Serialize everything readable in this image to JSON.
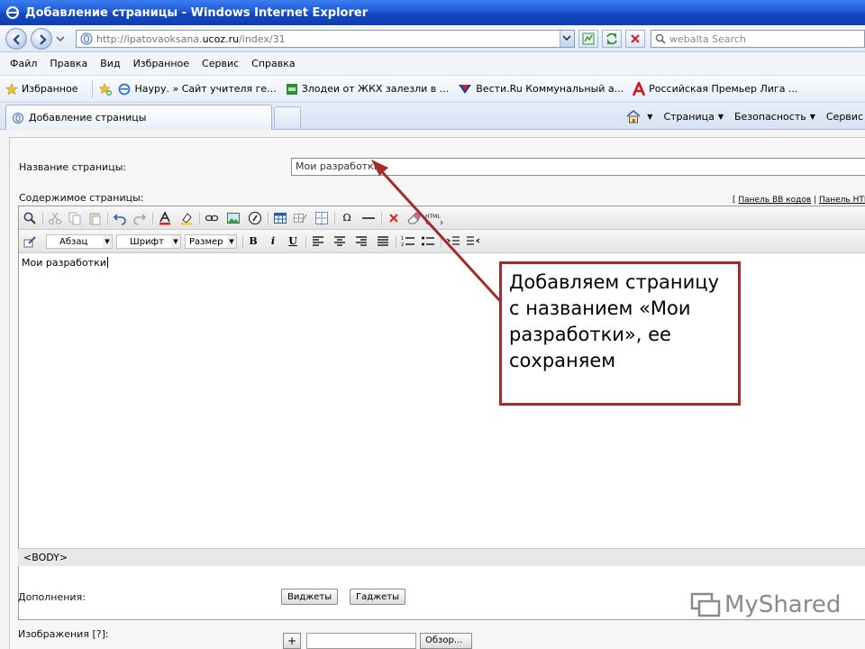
{
  "window": {
    "title": "Добавление страницы - Windows Internet Explorer"
  },
  "address_bar": {
    "url_prefix": "http://ipatovaoksana.",
    "url_host": "ucoz.ru",
    "url_path": "/index/31"
  },
  "search": {
    "placeholder": "webalta Search"
  },
  "menu": [
    "Файл",
    "Правка",
    "Вид",
    "Избранное",
    "Сервис",
    "Справка"
  ],
  "favorites": {
    "label": "Избранное",
    "items": [
      "Науру. » Сайт учителя ге...",
      "Злодеи от ЖКХ залезли в ...",
      "Вести.Ru Коммунальный а...",
      "Российская Премьер Лига ..."
    ]
  },
  "tabs": [
    {
      "label": "Добавление страницы"
    }
  ],
  "command_bar": {
    "page": "Страница",
    "safety": "Безопасность",
    "service": "Сервис"
  },
  "form": {
    "page_name_label": "Название страницы:",
    "page_name_value": "Мои разработки",
    "content_label": "Содержимое страницы:",
    "bb_panel_link": "Панель BB кодов",
    "html_panel_link": "Панель HTML к",
    "paragraph_select": "Абзац",
    "font_select": "Шрифт",
    "size_select": "Размер",
    "editor_text": "Мои разработки",
    "path_tag": "<BODY>",
    "additions_label": "Дополнения:",
    "widgets_button": "Виджеты",
    "gadgets_button": "Гаджеты",
    "images_label": "Изображения [?]:",
    "plus_button": "+",
    "browse_button": "Обзор..."
  },
  "annotation": {
    "text": "Добавляем страницу с названием «Мои разработки», ее сохраняем",
    "border_color": "#a52a2a"
  },
  "watermark": {
    "text": "MyShared"
  }
}
